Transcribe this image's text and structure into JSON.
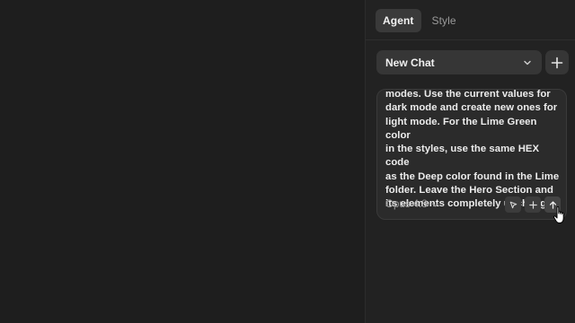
{
  "tabs": [
    {
      "label": "Agent",
      "active": true
    },
    {
      "label": "Style",
      "active": false
    }
  ],
  "chat_selector": {
    "value": "New Chat"
  },
  "composer": {
    "text": "modes. Use the current values for\ndark mode and create new ones for\nlight mode. For the Lime Green color\nin the styles, use the same HEX code\nas the Deep color found in the Lime\nfolder. Leave the Hero Section and\nits elements completely unchanged.",
    "model_label": "Opus 4.8"
  },
  "colors": {
    "canvas_bg": "#1e1e1e",
    "panel_bg": "#222222",
    "control_bg": "#363636",
    "composer_bg": "#2b2b2b",
    "text_primary": "#f0f0f0",
    "text_muted": "#9c9c9c"
  },
  "icons": {
    "chat_dropdown": "chevron-down-icon",
    "new_chat": "plus-icon",
    "model_dropdown": "chevron-down-icon",
    "pointer_tool": "cursor-arrow-icon",
    "attach": "plus-icon",
    "send": "arrow-up-icon",
    "mouse": "hand-pointer-cursor"
  }
}
